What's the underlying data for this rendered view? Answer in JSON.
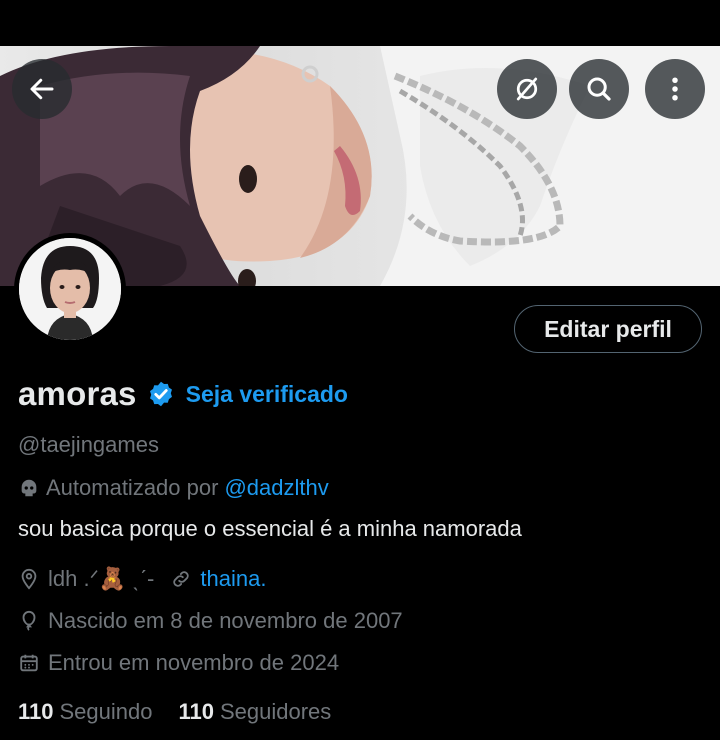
{
  "header": {
    "back_icon": "arrow-left-icon",
    "actions": [
      "no-notifications-icon",
      "search-icon",
      "more-vertical-icon"
    ]
  },
  "profile": {
    "display_name": "amoras",
    "verified_badge_color": "#1d9bf0",
    "get_verified_label": "Seja verificado",
    "handle": "@taejingames",
    "automated_prefix": "Automatizado por",
    "automated_by": "@dadzlthv",
    "bio": "sou basica porque o essencial é a minha namorada",
    "location": "ldh .ᐟ🧸 ˎˊ-",
    "website": "thaina.",
    "birthday": "Nascido em 8 de novembro de 2007",
    "joined": "Entrou em novembro de 2024",
    "following_count": "110",
    "following_label": "Seguindo",
    "followers_count": "110",
    "followers_label": "Seguidores"
  },
  "buttons": {
    "edit_profile": "Editar perfil"
  },
  "colors": {
    "background": "#000000",
    "text_primary": "#e7e9ea",
    "text_secondary": "#71767b",
    "accent": "#1d9bf0",
    "border": "#536471"
  }
}
